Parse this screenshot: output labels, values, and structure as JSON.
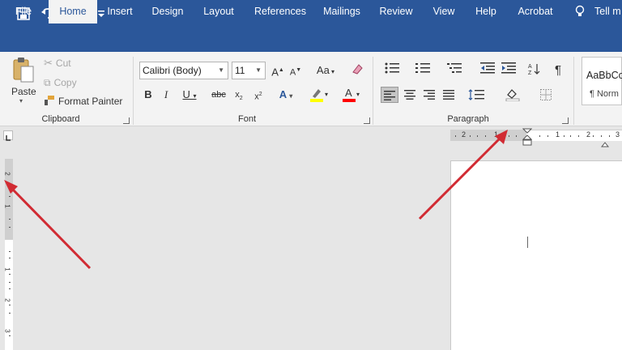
{
  "quick_access": {
    "save_icon": "save-icon",
    "undo_icon": "undo-icon",
    "redo_icon": "redo-icon",
    "customize_icon": "customize-qat-icon"
  },
  "tabs": [
    {
      "label": "File"
    },
    {
      "label": "Home"
    },
    {
      "label": "Insert"
    },
    {
      "label": "Design"
    },
    {
      "label": "Layout"
    },
    {
      "label": "References"
    },
    {
      "label": "Mailings"
    },
    {
      "label": "Review"
    },
    {
      "label": "View"
    },
    {
      "label": "Help"
    },
    {
      "label": "Acrobat"
    },
    {
      "label": "Tell m"
    }
  ],
  "clipboard": {
    "paste_label": "Paste",
    "cut_label": "Cut",
    "copy_label": "Copy",
    "format_painter_label": "Format Painter",
    "group_label": "Clipboard"
  },
  "font": {
    "font_name": "Calibri (Body)",
    "font_size": "11",
    "case_label": "Aa",
    "group_label": "Font"
  },
  "paragraph": {
    "group_label": "Paragraph"
  },
  "styles": {
    "preview_label": "AaBbCc",
    "normal_label": "¶ Norm"
  },
  "ruler": {
    "h_labels": [
      "2",
      "1",
      "1",
      "2",
      "3"
    ],
    "v_labels": [
      "2",
      "1",
      "1",
      "2",
      "3"
    ]
  },
  "colors": {
    "brand": "#2b579a",
    "arrow": "#d12b33",
    "highlight": "#ffff00",
    "font_color": "#ff0000"
  }
}
